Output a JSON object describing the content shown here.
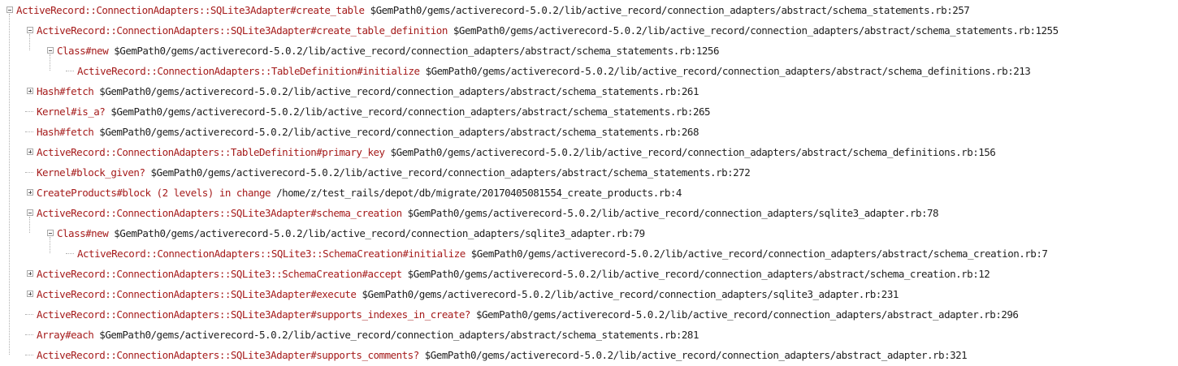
{
  "call_tree": {
    "rows": [
      {
        "method": "ActiveRecord::ConnectionAdapters::SQLite3Adapter#create_table",
        "path": "$GemPath0/gems/activerecord-5.0.2/lib/active_record/connection_adapters/abstract/schema_statements.rb:257",
        "depth": 0,
        "toggle": "minus"
      },
      {
        "method": "ActiveRecord::ConnectionAdapters::SQLite3Adapter#create_table_definition",
        "path": "$GemPath0/gems/activerecord-5.0.2/lib/active_record/connection_adapters/abstract/schema_statements.rb:1255",
        "depth": 1,
        "toggle": "minus"
      },
      {
        "method": "Class#new",
        "path": "$GemPath0/gems/activerecord-5.0.2/lib/active_record/connection_adapters/abstract/schema_statements.rb:1256",
        "depth": 2,
        "toggle": "minus"
      },
      {
        "method": "ActiveRecord::ConnectionAdapters::TableDefinition#initialize",
        "path": "$GemPath0/gems/activerecord-5.0.2/lib/active_record/connection_adapters/abstract/schema_definitions.rb:213",
        "depth": 3,
        "toggle": "none"
      },
      {
        "method": "Hash#fetch",
        "path": "$GemPath0/gems/activerecord-5.0.2/lib/active_record/connection_adapters/abstract/schema_statements.rb:261",
        "depth": 1,
        "toggle": "plus"
      },
      {
        "method": "Kernel#is_a?",
        "path": "$GemPath0/gems/activerecord-5.0.2/lib/active_record/connection_adapters/abstract/schema_statements.rb:265",
        "depth": 1,
        "toggle": "none"
      },
      {
        "method": "Hash#fetch",
        "path": "$GemPath0/gems/activerecord-5.0.2/lib/active_record/connection_adapters/abstract/schema_statements.rb:268",
        "depth": 1,
        "toggle": "none"
      },
      {
        "method": "ActiveRecord::ConnectionAdapters::TableDefinition#primary_key",
        "path": "$GemPath0/gems/activerecord-5.0.2/lib/active_record/connection_adapters/abstract/schema_definitions.rb:156",
        "depth": 1,
        "toggle": "plus"
      },
      {
        "method": "Kernel#block_given?",
        "path": "$GemPath0/gems/activerecord-5.0.2/lib/active_record/connection_adapters/abstract/schema_statements.rb:272",
        "depth": 1,
        "toggle": "none"
      },
      {
        "method": "CreateProducts#block (2 levels) in change",
        "path": "/home/z/test_rails/depot/db/migrate/20170405081554_create_products.rb:4",
        "depth": 1,
        "toggle": "plus"
      },
      {
        "method": "ActiveRecord::ConnectionAdapters::SQLite3Adapter#schema_creation",
        "path": "$GemPath0/gems/activerecord-5.0.2/lib/active_record/connection_adapters/sqlite3_adapter.rb:78",
        "depth": 1,
        "toggle": "minus"
      },
      {
        "method": "Class#new",
        "path": "$GemPath0/gems/activerecord-5.0.2/lib/active_record/connection_adapters/sqlite3_adapter.rb:79",
        "depth": 2,
        "toggle": "minus"
      },
      {
        "method": "ActiveRecord::ConnectionAdapters::SQLite3::SchemaCreation#initialize",
        "path": "$GemPath0/gems/activerecord-5.0.2/lib/active_record/connection_adapters/abstract/schema_creation.rb:7",
        "depth": 3,
        "toggle": "none"
      },
      {
        "method": "ActiveRecord::ConnectionAdapters::SQLite3::SchemaCreation#accept",
        "path": "$GemPath0/gems/activerecord-5.0.2/lib/active_record/connection_adapters/abstract/schema_creation.rb:12",
        "depth": 1,
        "toggle": "plus"
      },
      {
        "method": "ActiveRecord::ConnectionAdapters::SQLite3Adapter#execute",
        "path": "$GemPath0/gems/activerecord-5.0.2/lib/active_record/connection_adapters/sqlite3_adapter.rb:231",
        "depth": 1,
        "toggle": "plus"
      },
      {
        "method": "ActiveRecord::ConnectionAdapters::SQLite3Adapter#supports_indexes_in_create?",
        "path": "$GemPath0/gems/activerecord-5.0.2/lib/active_record/connection_adapters/abstract_adapter.rb:296",
        "depth": 1,
        "toggle": "none"
      },
      {
        "method": "Array#each",
        "path": "$GemPath0/gems/activerecord-5.0.2/lib/active_record/connection_adapters/abstract/schema_statements.rb:281",
        "depth": 1,
        "toggle": "none"
      },
      {
        "method": "ActiveRecord::ConnectionAdapters::SQLite3Adapter#supports_comments?",
        "path": "$GemPath0/gems/activerecord-5.0.2/lib/active_record/connection_adapters/abstract_adapter.rb:321",
        "depth": 1,
        "toggle": "none"
      }
    ]
  }
}
